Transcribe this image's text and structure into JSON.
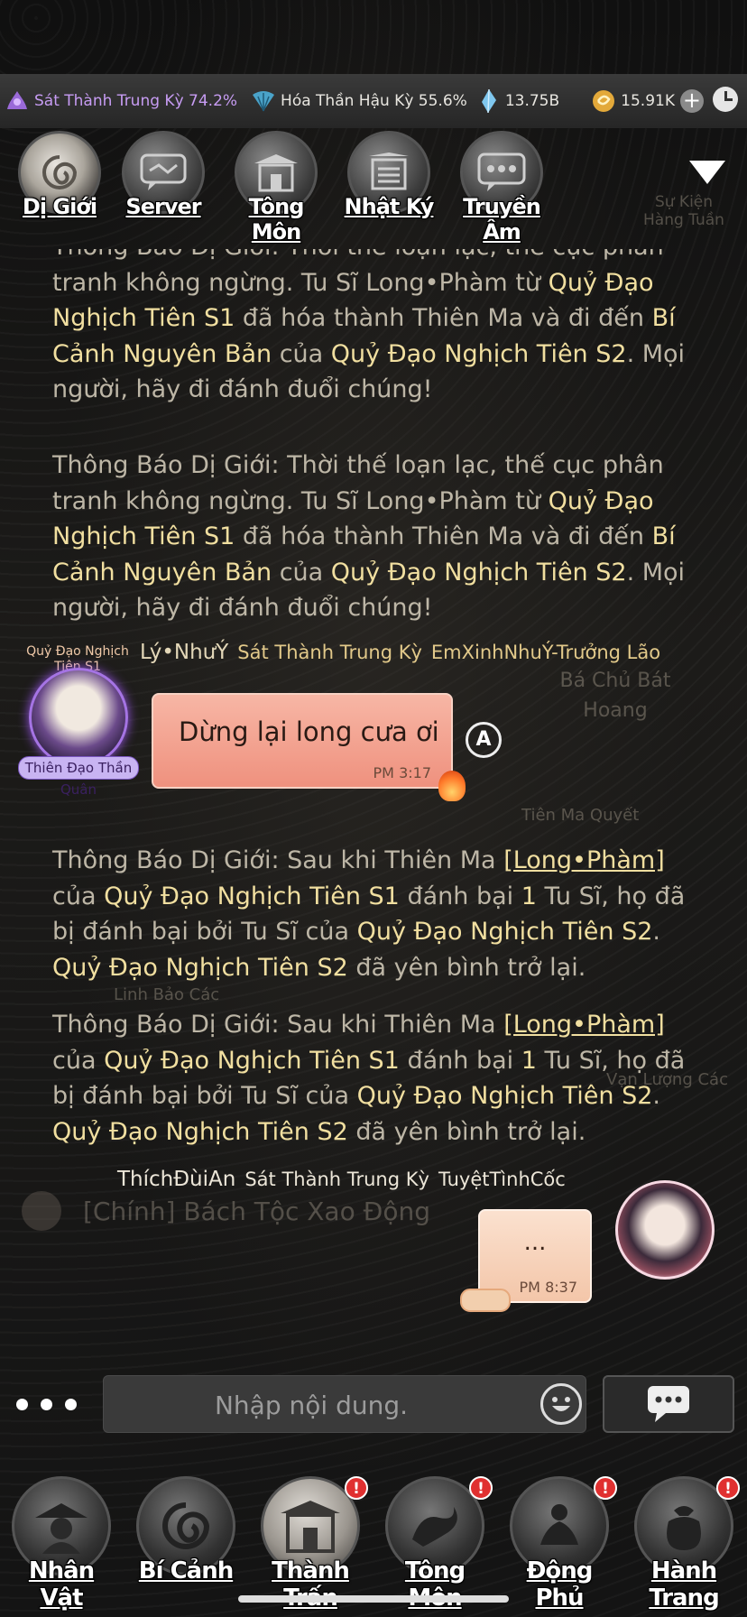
{
  "topbar": {
    "stats": [
      {
        "icon": "cultivation-lotus-icon",
        "label": "Sát Thành Trung Kỳ 74.2%"
      },
      {
        "icon": "fan-icon",
        "label": "Hóa Thần Hậu Kỳ 55.6%"
      },
      {
        "icon": "spirit-stone-icon",
        "label": "13.75B"
      },
      {
        "icon": "coin-icon",
        "label": "15.91K"
      }
    ],
    "add_label": "+"
  },
  "top_nav": [
    {
      "id": "di-gioi",
      "label": "Dị Giới",
      "icon": "swirl-icon"
    },
    {
      "id": "server",
      "label": "Server",
      "icon": "chat-bubble-icon"
    },
    {
      "id": "tong-mon",
      "label": "Tông Môn",
      "icon": "gate-icon"
    },
    {
      "id": "nhat-ky",
      "label": "Nhật Ký",
      "icon": "scroll-icon"
    },
    {
      "id": "truyen-am",
      "label": "Truyền Âm",
      "icon": "message-dots-icon"
    }
  ],
  "background_labels": {
    "su_kien_hang_tuan": "Sự Kiện Hàng Tuần",
    "tien_ma_quyet": "Tiên Ma Quyết",
    "linh_bao_cac": "Linh Bảo Các",
    "van_luong_cac": "Vạn Lượng Các",
    "ba_chu_bat_hoang": "Bá Chủ Bát Hoang",
    "tuyet_tinh_coc": "TuyệtTìnhCốc",
    "quest": "[Chính] Bách Tộc Xao Động"
  },
  "messages": {
    "sys1": {
      "part1": "Thông Báo Dị Giới: Thời thế loạn lạc, thế cục phân tranh không ngừng. Tu Sĩ Long•Phàm từ ",
      "server_a": "Quỷ Đạo Nghịch Tiên S1",
      "part2": " đã hóa thành Thiên Ma và đi đến ",
      "place": "Bí Cảnh Nguyên Bản",
      "part3": " của ",
      "server_b": "Quỷ Đạo Nghịch Tiên S2",
      "part4": ". Mọi người, hãy đi đánh đuổi chúng!"
    },
    "sys2": {
      "part1": "Thông Báo Dị Giới: Thời thế loạn lạc, thế cục phân tranh không ngừng. Tu Sĩ Long•Phàm từ ",
      "server_a": "Quỷ Đạo Nghịch Tiên S1",
      "part2": " đã hóa thành Thiên Ma và đi đến ",
      "place": "Bí Cảnh Nguyên Bản",
      "part3": " của ",
      "server_b": "Quỷ Đạo Nghịch Tiên S2",
      "part4": ". Mọi người, hãy đi đánh đuổi chúng!"
    },
    "chat1": {
      "avatar_top": "Quỷ Đạo Nghịch Tiên S1",
      "avatar_bottom": "Thiên Đạo Thần Quân",
      "name": "Lý•NhưÝ",
      "rank": "Sát Thành Trung Kỳ",
      "guild": "EmXinhNhuÝ-Trưởng Lão",
      "text": "Dừng lại long cưa ơi",
      "time": "PM 3:17",
      "translate_label": "A"
    },
    "sys3": {
      "part1": "Thông Báo Dị Giới: Sau khi Thiên Ma ",
      "player": "[Long•Phàm]",
      "part2": " của ",
      "server_a": "Quỷ Đạo Nghịch Tiên S1",
      "part3": " đánh bại ",
      "count": "1",
      "part4": " Tu Sĩ, họ đã bị đánh bại bởi Tu Sĩ của ",
      "server_b": "Quỷ Đạo Nghịch Tiên S2",
      "part5": ". ",
      "server_c": "Quỷ Đạo Nghịch Tiên S2",
      "part6": " đã yên bình trở lại."
    },
    "sys4": {
      "part1": "Thông Báo Dị Giới: Sau khi Thiên Ma ",
      "player": "[Long•Phàm]",
      "part2": " của ",
      "server_a": "Quỷ Đạo Nghịch Tiên S1",
      "part3": " đánh bại ",
      "count": "1",
      "part4": " Tu Sĩ, họ đã bị đánh bại bởi Tu Sĩ của ",
      "server_b": "Quỷ Đạo Nghịch Tiên S2",
      "part5": ". ",
      "server_c": "Quỷ Đạo Nghịch Tiên S2",
      "part6": " đã yên bình trở lại."
    },
    "chat2": {
      "name": "ThíchĐùiAn",
      "rank": "Sát Thành Trung Kỳ",
      "guild": "TuyệtTìnhCốc",
      "text": "...",
      "time": "PM 8:37"
    }
  },
  "input": {
    "placeholder": "Nhập nội dung."
  },
  "bottom_nav": [
    {
      "id": "nhan-vat",
      "label": "Nhân Vật",
      "badge": false
    },
    {
      "id": "bi-canh",
      "label": "Bí Cảnh",
      "badge": false
    },
    {
      "id": "thanh-tran",
      "label": "Thành Trấn",
      "badge": true
    },
    {
      "id": "tong-mon",
      "label": "Tông Môn",
      "badge": true
    },
    {
      "id": "dong-phu",
      "label": "Động Phủ",
      "badge": true
    },
    {
      "id": "hanh-trang",
      "label": "Hành Trang",
      "badge": true
    }
  ],
  "badge_symbol": "!",
  "colors": {
    "highlight": "#f1dfa0",
    "system_text": "#bdb6a6",
    "bubble_pink": "#f29a86",
    "bubble_peach": "#f6d3bb",
    "badge_red": "#e03030"
  }
}
